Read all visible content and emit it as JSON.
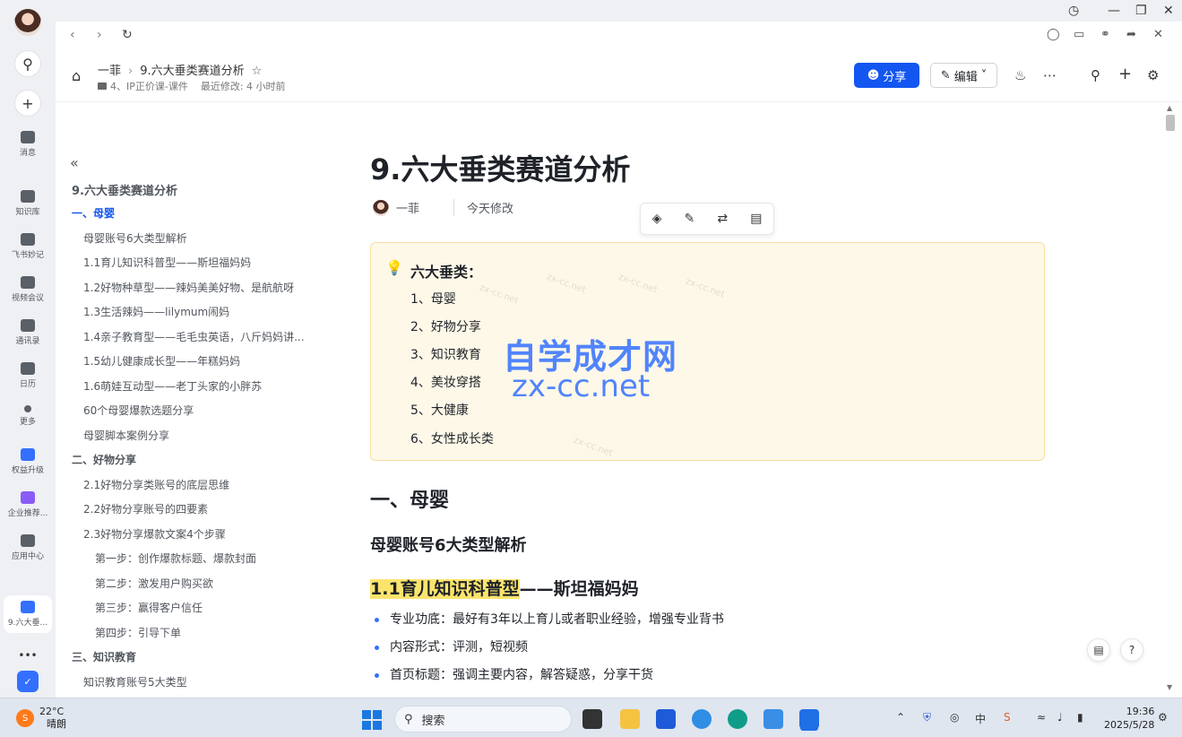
{
  "rail": {
    "items": [
      {
        "label": "消息"
      },
      {
        "label": "知识库"
      },
      {
        "label": "飞书妙记"
      },
      {
        "label": "视频会议"
      },
      {
        "label": "通讯录"
      },
      {
        "label": "日历"
      },
      {
        "label": "更多"
      },
      {
        "label": "权益升级"
      },
      {
        "label": "企业推荐..."
      },
      {
        "label": "应用中心"
      },
      {
        "label": "9.六大垂..."
      }
    ]
  },
  "header": {
    "crumb_parent": "一菲",
    "crumb_current": "9.六大垂类赛道分析",
    "folder": "4、IP正价课-课件",
    "last_modified": "最近修改: 4 小时前",
    "share_label": "分享",
    "edit_label": "编辑"
  },
  "outline": {
    "title": "9.六大垂类赛道分析",
    "items": [
      {
        "text": "一、母婴",
        "level": "h1"
      },
      {
        "text": "母婴账号6大类型解析",
        "level": "h2"
      },
      {
        "text": "1.1育儿知识科普型——斯坦福妈妈",
        "level": "h2"
      },
      {
        "text": "1.2好物种草型——辣妈美美好物、是航航呀",
        "level": "h2"
      },
      {
        "text": "1.3生活辣妈——lilymum闹妈",
        "level": "h2"
      },
      {
        "text": "1.4亲子教育型——毛毛虫英语，八斤妈妈讲...",
        "level": "h2"
      },
      {
        "text": "1.5幼儿健康成长型——年糕妈妈",
        "level": "h2"
      },
      {
        "text": "1.6萌娃互动型——老丁头家的小胖苏",
        "level": "h2"
      },
      {
        "text": "60个母婴爆款选题分享",
        "level": "h2"
      },
      {
        "text": "母婴脚本案例分享",
        "level": "h2"
      },
      {
        "text": "二、好物分享",
        "level": "h1"
      },
      {
        "text": "2.1好物分享类账号的底层思维",
        "level": "h2"
      },
      {
        "text": "2.2好物分享账号的四要素",
        "level": "h2"
      },
      {
        "text": "2.3好物分享爆款文案4个步骤",
        "level": "h2"
      },
      {
        "text": "第一步：创作爆款标题、爆款封面",
        "level": "h3"
      },
      {
        "text": "第二步：激发用户购买欲",
        "level": "h3"
      },
      {
        "text": "第三步：赢得客户信任",
        "level": "h3"
      },
      {
        "text": "第四步：引导下单",
        "level": "h3"
      },
      {
        "text": "三、知识教育",
        "level": "h1"
      },
      {
        "text": "知识教育账号5大类型",
        "level": "h2"
      }
    ]
  },
  "doc": {
    "title": "9.六大垂类赛道分析",
    "author": "一菲",
    "edited": "今天修改",
    "callout_title": "六大垂类：",
    "callout_items": [
      "1、母婴",
      "2、好物分享",
      "3、知识教育",
      "4、美妆穿搭",
      "5、大健康",
      "6、女性成长类"
    ],
    "watermark_cn": "自学成才网",
    "watermark_en": "zx-cc.net",
    "faint_mark": "zx-cc.net",
    "section_h1": "一、母婴",
    "section_h2": "母婴账号6大类型解析",
    "section_h3_hl": "1.1育儿知识科普型",
    "section_h3_rest": "——斯坦福妈妈",
    "bullets": [
      "专业功底：最好有3年以上育儿或者职业经验，增强专业背书",
      "内容形式：评测，短视频",
      "首页标题：强调主要内容，解答疑惑，分享干货"
    ]
  },
  "taskbar": {
    "temp": "22°C",
    "weather": "晴朗",
    "search": "搜索",
    "time": "19:36",
    "date": "2025/5/28",
    "ime": "中"
  },
  "colors": {
    "accent": "#1456f0",
    "callout_bg": "#fef8e8",
    "highlight": "#fbe46d"
  }
}
